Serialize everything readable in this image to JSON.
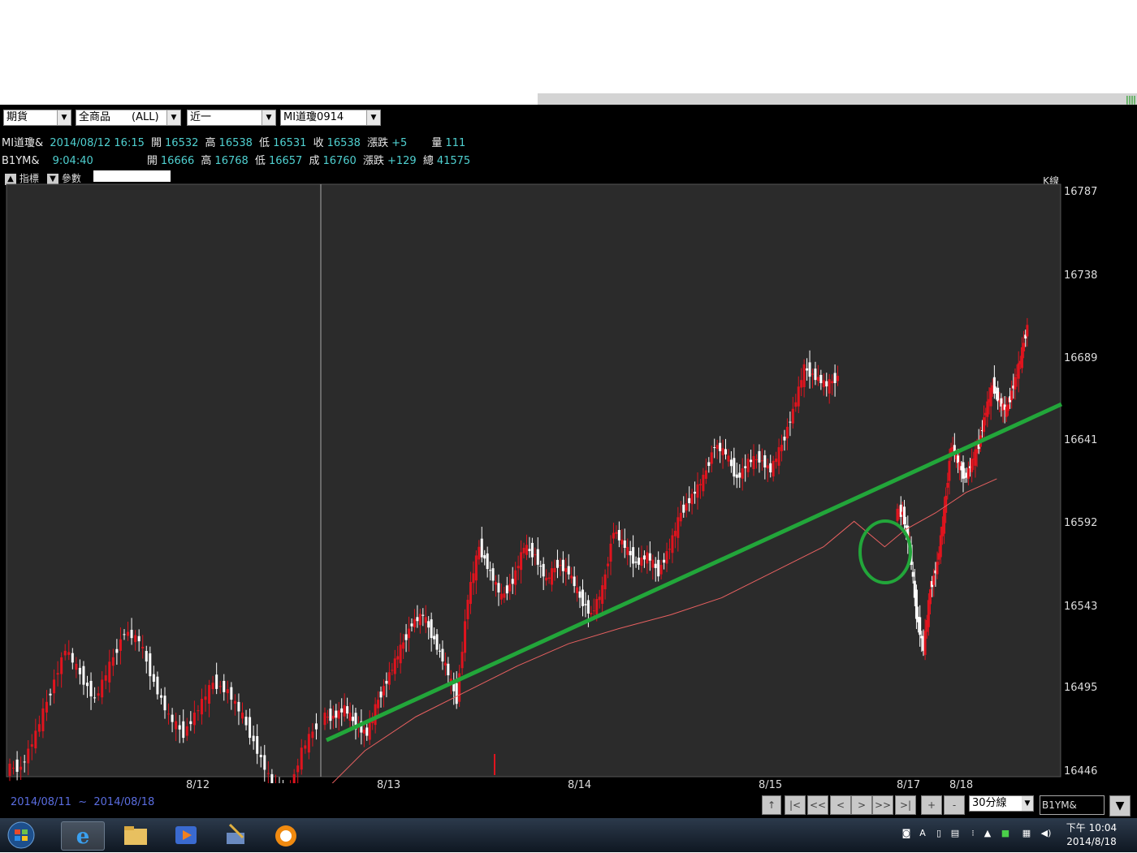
{
  "toolbar": {
    "market_select": "期貨",
    "product_select": "全商品　　(ALL)",
    "month_select": "近一",
    "contract_select": "MI道瓊0914"
  },
  "quote1": {
    "symbol": "MI道瓊&",
    "datetime": "2014/08/12 16:15",
    "open_label": "開",
    "open": "16532",
    "high_label": "高",
    "high": "16538",
    "low_label": "低",
    "low": "16531",
    "close_label": "收",
    "close": "16538",
    "change_label": "漲跌",
    "change": "+5",
    "volume_label": "量",
    "volume": "111"
  },
  "quote2": {
    "symbol": "B1YM&",
    "time": "9:04:40",
    "open_label": "開",
    "open": "16666",
    "high_label": "高",
    "high": "16768",
    "low_label": "低",
    "low": "16657",
    "last_label": "成",
    "last": "16760",
    "change_label": "漲跌",
    "change": "+129",
    "total_label": "總",
    "total": "41575"
  },
  "chart_toolbar": {
    "indicator_label": "指標",
    "param_label": "參數",
    "chart_type": "K線"
  },
  "date_range": {
    "from": "2014/08/11",
    "sep": "~",
    "to": "2014/08/18"
  },
  "nav_buttons": [
    "↑",
    "|<",
    "<<",
    "<",
    ">",
    ">>",
    ">|",
    "+",
    "-"
  ],
  "period_select": "30分線",
  "symbol_input": "B1YM&",
  "clock": {
    "time": "下午 10:04",
    "date": "2014/8/18"
  },
  "colors": {
    "up": "#e0141e",
    "down": "#ffffff",
    "ma": "#e86060",
    "trend": "#22a63a",
    "bg": "#2b2b2b"
  },
  "chart_data": {
    "type": "candlestick",
    "title": "",
    "xlabel": "",
    "ylabel": "",
    "ylim": [
      16446,
      16787
    ],
    "yticks": [
      16787,
      16738,
      16689,
      16641,
      16592,
      16543,
      16495,
      16446
    ],
    "xticks": [
      "8/12",
      "8/13",
      "8/14",
      "8/15",
      "8/17",
      "8/18"
    ],
    "annotations": [
      "green trend line",
      "green circle"
    ],
    "moving_average": [
      [
        0,
        16446
      ],
      [
        0.22,
        16446
      ],
      [
        0.25,
        16460
      ],
      [
        0.3,
        16480
      ],
      [
        0.35,
        16510
      ],
      [
        0.4,
        16530
      ],
      [
        0.45,
        16545
      ],
      [
        0.5,
        16560
      ],
      [
        0.55,
        16573
      ],
      [
        0.6,
        16582
      ],
      [
        0.65,
        16590
      ],
      [
        0.7,
        16600
      ],
      [
        0.75,
        16615
      ],
      [
        0.8,
        16630
      ],
      [
        0.83,
        16645
      ],
      [
        0.86,
        16630
      ],
      [
        0.88,
        16640
      ],
      [
        0.91,
        16650
      ],
      [
        0.94,
        16662
      ],
      [
        0.97,
        16670
      ]
    ],
    "segments": [
      [
        16500,
        16520,
        16545,
        16570,
        16555,
        16540,
        16560,
        16580,
        16575,
        16550,
        16530,
        16520,
        16535,
        16550,
        16545,
        16530,
        16510,
        16490,
        16480,
        16510,
        16525
      ],
      [
        16530,
        16535,
        16525,
        16520,
        16540,
        16555,
        16570,
        16585,
        16590,
        16575,
        16560,
        16540,
        16600,
        16630,
        16615,
        16600,
        16610,
        16630,
        16625,
        16610,
        16620,
        16615,
        16600,
        16590,
        16605,
        16640,
        16630,
        16620,
        16625,
        16615,
        16630,
        16650,
        16660,
        16670,
        16690,
        16685,
        16670,
        16680,
        16682,
        16675,
        16690,
        16710,
        16735,
        16730,
        16725,
        16730
      ],
      [
        16650,
        16630,
        16590,
        16570,
        16605,
        16620,
        16650,
        16690,
        16680,
        16670,
        16680,
        16690,
        16710,
        16725,
        16715,
        16710,
        16725,
        16740,
        16760
      ]
    ]
  }
}
